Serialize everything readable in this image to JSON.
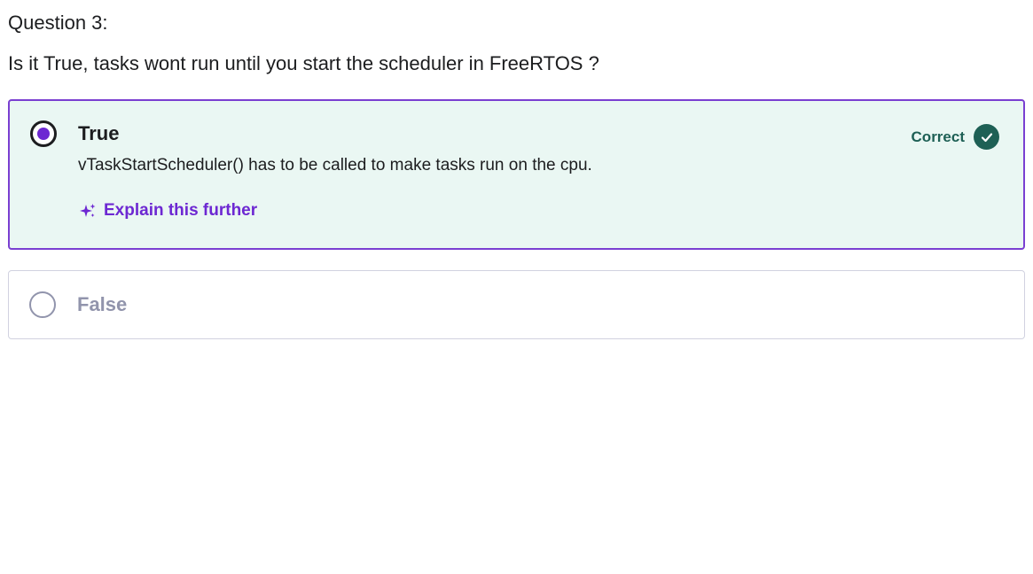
{
  "question": {
    "label": "Question 3:",
    "text": "Is it True, tasks wont run until you start the scheduler in FreeRTOS ?"
  },
  "options": [
    {
      "label": "True",
      "selected": true,
      "status": "Correct",
      "explanation": "vTaskStartScheduler() has to be called to make tasks run on the cpu.",
      "explain_link": "Explain this further"
    },
    {
      "label": "False",
      "selected": false
    }
  ],
  "icons": {
    "selected_radio": "radio-selected-icon",
    "empty_radio": "radio-empty-icon",
    "check": "check-circle-icon",
    "sparkle": "sparkle-icon"
  },
  "colors": {
    "accent": "#6d28d2",
    "correct_green": "#1e6055",
    "correct_bg": "#eaf7f3",
    "selected_border": "#7a3fd1",
    "muted": "#9194ac"
  }
}
